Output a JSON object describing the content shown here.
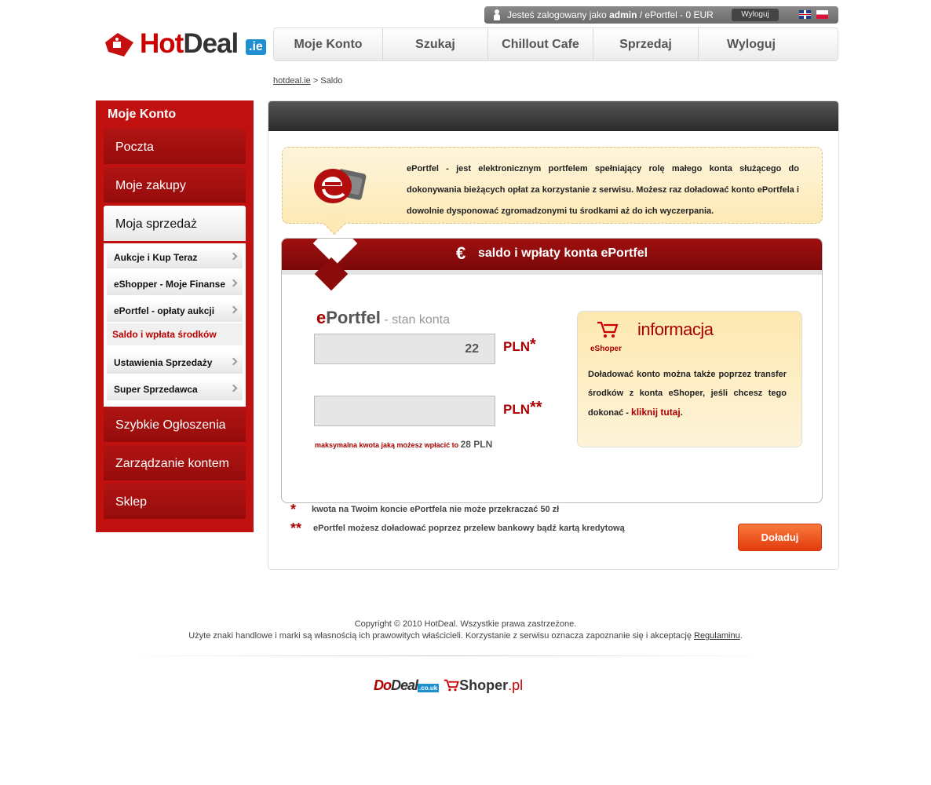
{
  "userbar": {
    "prefix": "Jesteś zalogowany jako ",
    "username": "admin",
    "suffix": " / ePortfel - 0 EUR",
    "logout": "Wyloguj"
  },
  "logo": {
    "hot": "Hot",
    "deal": "Deal",
    "tld": ".ie"
  },
  "nav": [
    "Moje Konto",
    "Szukaj",
    "Chillout Cafe",
    "Sprzedaj",
    "Wyloguj"
  ],
  "breadcrumb": {
    "home": "hotdeal.ie",
    "sep": " > ",
    "current": "Saldo"
  },
  "sidebar": {
    "title": "Moje Konto",
    "items": [
      "Poczta",
      "Moje zakupy",
      "Moja sprzedaż",
      "Szybkie Ogłoszenia",
      "Zarządzanie kontem",
      "Sklep"
    ],
    "subitems": [
      "Aukcje i Kup Teraz",
      "eShopper - Moje Finanse",
      "ePortfel - opłaty aukcji",
      "Saldo i wpłata środków",
      "Ustawienia Sprzedaży",
      "Super Sprzedawca"
    ]
  },
  "info": {
    "text": "ePortfel - jest elektronicznym portfelem spełniający rolę małego konta służącego do dokonywania bieżących opłat za korzystanie z serwisu. Możesz raz doładować konto ePortfela i dowolnie dysponować zgromadzonymi tu środkami  aż do ich wyczerpania."
  },
  "saldo": {
    "euro": "€",
    "title": "saldo i wpłaty konta ePortfel",
    "ep_e": "e",
    "ep_rest": "Portfel",
    "ep_sub": " - stan konta",
    "balance": "22",
    "currency1": "PLN",
    "star1": "*",
    "amount": "",
    "currency2": "PLN",
    "star2": "**",
    "max_label": "maksymalna kwota jaką możesz wpłacić to ",
    "max_value": "28 PLN"
  },
  "eshoper": {
    "brand": "eShoper",
    "title": "informacja",
    "text": "Doładować konto można także poprzez transfer środków z konta eShoper, jeśli chcesz tego dokonać - ",
    "link": "kliknij tutaj",
    "after": "."
  },
  "notes": {
    "star1": "*",
    "note1": "kwota na Twoim koncie ePortfela nie może przekraczać 50 zł",
    "star2": "**",
    "note2": "ePortfel możesz doładować poprzez przelew bankowy bądź kartą kredytową"
  },
  "button": "Doładuj",
  "footer": {
    "line1": "Copyright © 2010 HotDeal. Wszystkie prawa zastrzeżone.",
    "line2": "Użyte znaki handlowe i marki są własnością ich prawowitych właścicieli. Korzystanie z serwisu oznacza zapoznanie się i akceptację ",
    "link": "Regulaminu",
    "end": "."
  },
  "partners": {
    "dodeal_1": "Do",
    "dodeal_2": "Deal",
    "dodeal_tld": ".co.uk",
    "shoper": "Shoper",
    "shoper_tld": ".pl"
  }
}
